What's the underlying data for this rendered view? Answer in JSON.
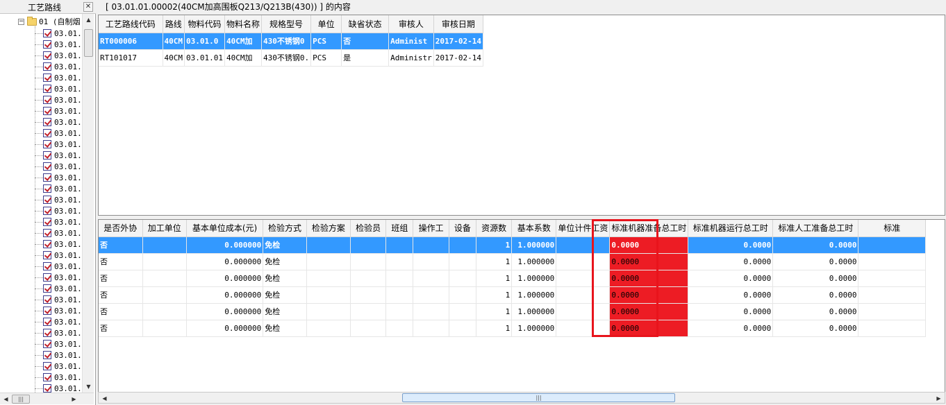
{
  "left_pane": {
    "title": "工艺路线",
    "close_glyph": "✕",
    "root_expander": "−",
    "root_label": "01 (自制烟",
    "item_label": "03.01.0",
    "item_count": 33,
    "scroll_up": "▲",
    "scroll_down": "▼",
    "scroll_left": "◀",
    "scroll_right": "▶",
    "grip": "|||"
  },
  "content_title": "[ 03.01.01.00002(40CM加高围板Q213/Q213B(430)) ]  的内容",
  "routes_table": {
    "columns": [
      "工艺路线代码",
      "路线",
      "物料代码",
      "物料名称",
      "规格型号",
      "单位",
      "缺省状态",
      "审核人",
      "审核日期"
    ],
    "rows": [
      [
        "RT000006",
        "40CM",
        "03.01.0",
        "40CM加",
        "430不锈钢0",
        "PCS",
        "否",
        "Administ",
        "2017-02-14"
      ],
      [
        "RT101017",
        "40CM",
        "03.01.01",
        "40CM加",
        "430不锈钢0.",
        "PCS",
        "是",
        "Administr",
        "2017-02-14"
      ]
    ],
    "selected_row": 0
  },
  "steps_table": {
    "columns": [
      "是否外协",
      "加工单位",
      "基本单位成本(元)",
      "检验方式",
      "检验方案",
      "检验员",
      "班组",
      "操作工",
      "设备",
      "资源数",
      "基本系数",
      "单位计件工资",
      "标准机器准备总工时",
      "标准机器运行总工时",
      "标准人工准备总工时",
      "标准"
    ],
    "rows": [
      [
        "否",
        "",
        "0.000000",
        "免检",
        "",
        "",
        "",
        "",
        "",
        "1",
        "1.000000",
        "",
        "0.0000",
        "0.0000",
        "0.0000",
        ""
      ],
      [
        "否",
        "",
        "0.000000",
        "免检",
        "",
        "",
        "",
        "",
        "",
        "1",
        "1.000000",
        "",
        "0.0000",
        "0.0000",
        "0.0000",
        ""
      ],
      [
        "否",
        "",
        "0.000000",
        "免检",
        "",
        "",
        "",
        "",
        "",
        "1",
        "1.000000",
        "",
        "0.0000",
        "0.0000",
        "0.0000",
        ""
      ],
      [
        "否",
        "",
        "0.000000",
        "免检",
        "",
        "",
        "",
        "",
        "",
        "1",
        "1.000000",
        "",
        "0.0000",
        "0.0000",
        "0.0000",
        ""
      ],
      [
        "否",
        "",
        "0.000000",
        "免检",
        "",
        "",
        "",
        "",
        "",
        "1",
        "1.000000",
        "",
        "0.0000",
        "0.0000",
        "0.0000",
        ""
      ],
      [
        "否",
        "",
        "0.000000",
        "免检",
        "",
        "",
        "",
        "",
        "",
        "1",
        "1.000000",
        "",
        "0.0000",
        "0.0000",
        "0.0000",
        ""
      ]
    ],
    "selected_row": 0,
    "highlighted_column": "单位计件工资",
    "highlight_color": "#e8141c",
    "redaction_color": "#ed1c24"
  },
  "colors": {
    "selection": "#3399ff",
    "folder": "#f6d36a"
  }
}
